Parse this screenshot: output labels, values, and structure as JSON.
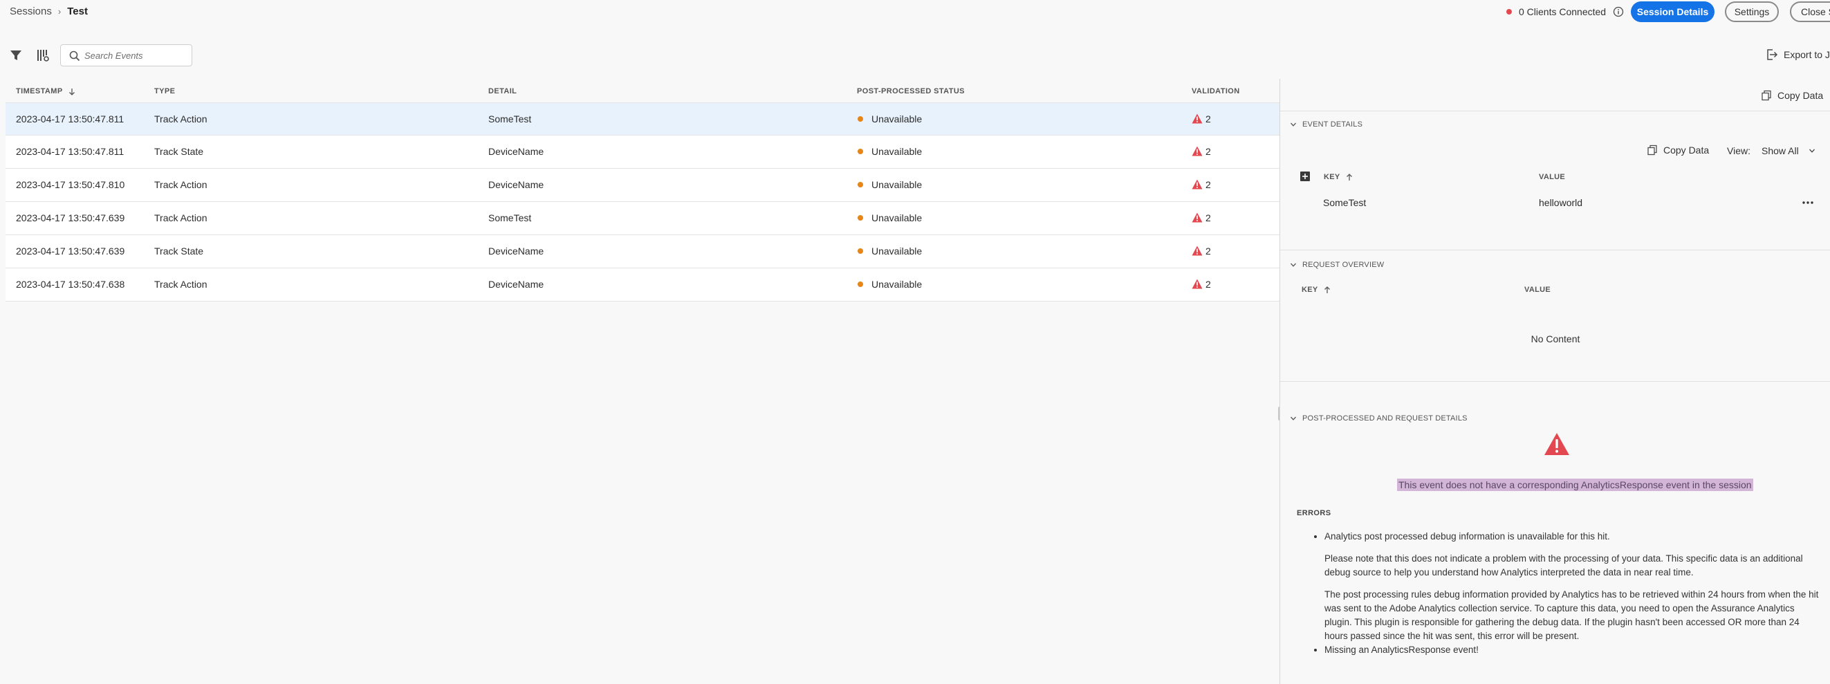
{
  "header": {
    "breadcrumb_root": "Sessions",
    "breadcrumb_current": "Test",
    "clients_connected": "0 Clients Connected",
    "session_details_label": "Session Details",
    "settings_label": "Settings",
    "close_label": "Close Session"
  },
  "toolbar": {
    "search_placeholder": "Search Events",
    "export_label": "Export to JSON"
  },
  "table": {
    "columns": {
      "timestamp": "TIMESTAMP",
      "type": "TYPE",
      "detail": "DETAIL",
      "status": "POST-PROCESSED STATUS",
      "validation": "VALIDATION"
    },
    "rows": [
      {
        "timestamp": "2023-04-17 13:50:47.811",
        "type": "Track Action",
        "detail": "SomeTest",
        "status": "Unavailable",
        "validation": "2"
      },
      {
        "timestamp": "2023-04-17 13:50:47.811",
        "type": "Track State",
        "detail": "DeviceName",
        "status": "Unavailable",
        "validation": "2"
      },
      {
        "timestamp": "2023-04-17 13:50:47.810",
        "type": "Track Action",
        "detail": "DeviceName",
        "status": "Unavailable",
        "validation": "2"
      },
      {
        "timestamp": "2023-04-17 13:50:47.639",
        "type": "Track Action",
        "detail": "SomeTest",
        "status": "Unavailable",
        "validation": "2"
      },
      {
        "timestamp": "2023-04-17 13:50:47.639",
        "type": "Track State",
        "detail": "DeviceName",
        "status": "Unavailable",
        "validation": "2"
      },
      {
        "timestamp": "2023-04-17 13:50:47.638",
        "type": "Track Action",
        "detail": "DeviceName",
        "status": "Unavailable",
        "validation": "2"
      }
    ]
  },
  "panel": {
    "copy_data_label": "Copy Data",
    "event_details": {
      "title": "EVENT DETAILS",
      "copy_data_label": "Copy Data",
      "view_label": "View:",
      "view_value": "Show All",
      "key_header": "KEY",
      "value_header": "VALUE",
      "rows": [
        {
          "key": "SomeTest",
          "value": "helloworld"
        }
      ]
    },
    "request_overview": {
      "title": "REQUEST OVERVIEW",
      "key_header": "KEY",
      "value_header": "VALUE",
      "empty_text": "No Content"
    },
    "post_processed": {
      "title": "POST-PROCESSED AND REQUEST DETAILS",
      "message": "This event does not have a corresponding AnalyticsResponse event in the session",
      "errors_label": "ERRORS",
      "error_1_title": "Analytics post processed debug information is unavailable for this hit.",
      "error_1_para_1": "Please note that this does not indicate a problem with the processing of your data. This specific data is an additional debug source to help you understand how Analytics interpreted the data in near real time.",
      "error_1_para_2": "The post processing rules debug information provided by Analytics has to be retrieved within 24 hours from when the hit was sent to the Adobe Analytics collection service. To capture this data, you need to open the Assurance Analytics plugin. This plugin is responsible for gathering the debug data. If the plugin hasn't been accessed OR more than 24 hours passed since the hit was sent, this error will be present.",
      "error_2_title": "Missing an AnalyticsResponse event!"
    }
  },
  "colors": {
    "accent": "#1473e6",
    "selected_row": "#e8f2fc",
    "status_dot": "#e68619",
    "warning": "#e34850",
    "highlight": "#d3b5d8"
  }
}
